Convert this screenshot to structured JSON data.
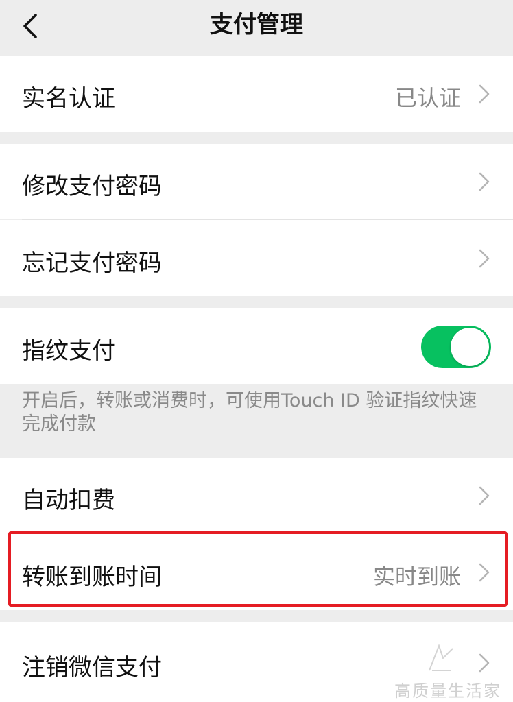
{
  "nav": {
    "title": "支付管理",
    "back_icon": "chevron-left-icon"
  },
  "rows": {
    "real_name": {
      "label": "实名认证",
      "value": "已认证"
    },
    "change_password": {
      "label": "修改支付密码"
    },
    "forgot_password": {
      "label": "忘记支付密码"
    },
    "fingerprint": {
      "label": "指纹支付",
      "enabled": true
    },
    "auto_deduct": {
      "label": "自动扣费"
    },
    "transfer_time": {
      "label": "转账到账时间",
      "value": "实时到账"
    },
    "cancel_pay": {
      "label": "注销微信支付"
    }
  },
  "hint": {
    "fingerprint": "开启后，转账或消费时，可使用Touch ID 验证指纹快速完成付款"
  },
  "watermark": {
    "text": "高质量生活家"
  },
  "colors": {
    "toggle_on": "#07c160",
    "highlight_border": "#e51c23",
    "background": "#ededed",
    "cell": "#ffffff"
  }
}
